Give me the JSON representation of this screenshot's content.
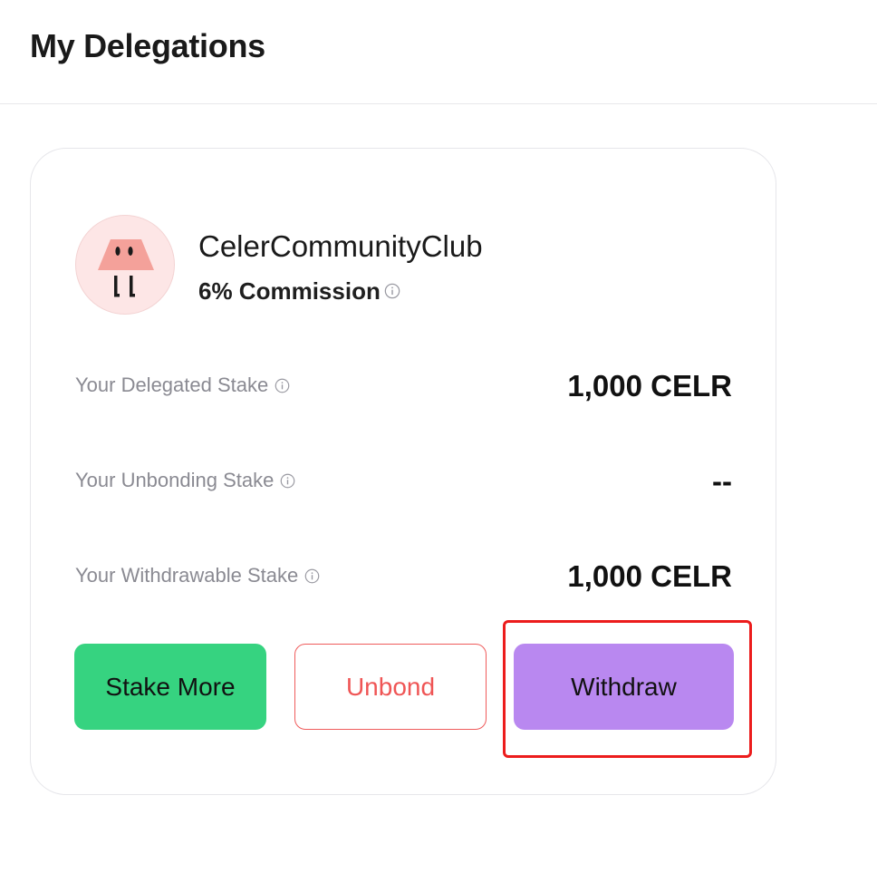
{
  "header": {
    "title": "My Delegations"
  },
  "validator": {
    "name": "CelerCommunityClub",
    "commission": "6% Commission",
    "avatar_icon": "celer-mascot-icon",
    "avatar_bg": "#fde6e6"
  },
  "stats": {
    "delegated": {
      "label": "Your Delegated Stake",
      "value": "1,000 CELR"
    },
    "unbonding": {
      "label": "Your Unbonding Stake",
      "value": "--"
    },
    "withdrawable": {
      "label": "Your Withdrawable Stake",
      "value": "1,000 CELR"
    }
  },
  "buttons": {
    "stake_more": "Stake More",
    "unbond": "Unbond",
    "withdraw": "Withdraw"
  },
  "colors": {
    "stake_more_bg": "#36d380",
    "unbond_border": "#ef5b5b",
    "withdraw_bg": "#b988f0",
    "highlight": "#ec1c1c"
  }
}
